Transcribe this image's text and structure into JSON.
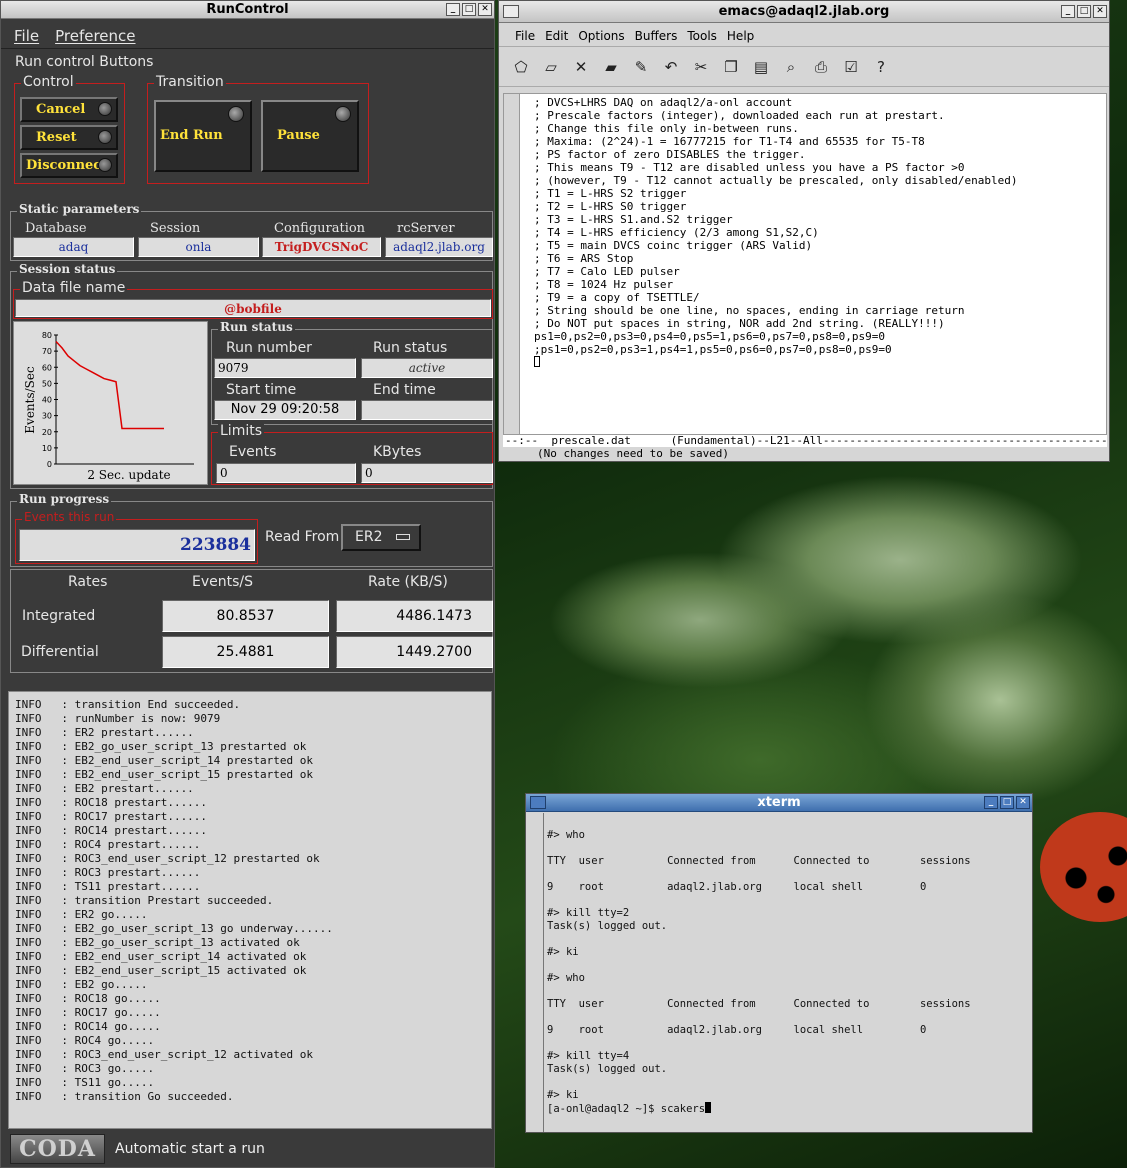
{
  "runcontrol": {
    "title": "RunControl",
    "menu": [
      "File",
      "Preference"
    ],
    "run_control_buttons_label": "Run control Buttons",
    "control_label": "Control",
    "transition_label": "Transition",
    "buttons": {
      "cancel": "Cancel",
      "reset": "Reset",
      "disconnect": "Disconnect",
      "end_run": "End Run",
      "pause": "Pause"
    },
    "static_params_label": "Static parameters",
    "static_params": {
      "database_label": "Database",
      "database": "adaq",
      "session_label": "Session",
      "session": "onla",
      "configuration_label": "Configuration",
      "configuration": "TrigDVCSNoC",
      "rcserver_label": "rcServer",
      "rcserver": "adaql2.jlab.org"
    },
    "session_status_label": "Session status",
    "data_file_label": "Data file name",
    "data_file": "@bobfile",
    "graph": {
      "ylabel": "Events/Sec",
      "xlabel": "2 Sec. update",
      "yticks": [
        "80",
        "70",
        "60",
        "50",
        "40",
        "30",
        "20",
        "10",
        "0"
      ]
    },
    "run_status_label": "Run status",
    "run_number_label": "Run number",
    "run_number": "9079",
    "run_state_label": "Run status",
    "run_state": "active",
    "start_time_label": "Start time",
    "start_time": "Nov 29 09:20:58",
    "end_time_label": "End time",
    "end_time": "",
    "limits_label": "Limits",
    "events_limit_label": "Events",
    "events_limit": "0",
    "kbytes_limit_label": "KBytes",
    "kbytes_limit": "0",
    "run_progress_label": "Run progress",
    "events_this_run_label": "Events this run",
    "events_this_run": "223884",
    "read_from_label": "Read From:",
    "read_from": "ER2",
    "rates": {
      "header": [
        "Rates",
        "Events/S",
        "Rate (KB/S)"
      ],
      "integrated_label": "Integrated",
      "integrated_events": "80.8537",
      "integrated_rate": "4486.1473",
      "differential_label": "Differential",
      "differential_events": "25.4881",
      "differential_rate": "1449.2700"
    },
    "log": "INFO   : transition End succeeded.\nINFO   : runNumber is now: 9079\nINFO   : ER2 prestart......\nINFO   : EB2_go_user_script_13 prestarted ok\nINFO   : EB2_end_user_script_14 prestarted ok\nINFO   : EB2_end_user_script_15 prestarted ok\nINFO   : EB2 prestart......\nINFO   : ROC18 prestart......\nINFO   : ROC17 prestart......\nINFO   : ROC14 prestart......\nINFO   : ROC4 prestart......\nINFO   : ROC3_end_user_script_12 prestarted ok\nINFO   : ROC3 prestart......\nINFO   : TS11 prestart......\nINFO   : transition Prestart succeeded.\nINFO   : ER2 go.....\nINFO   : EB2_go_user_script_13 go underway......\nINFO   : EB2_go_user_script_13 activated ok\nINFO   : EB2_end_user_script_14 activated ok\nINFO   : EB2_end_user_script_15 activated ok\nINFO   : EB2 go.....\nINFO   : ROC18 go.....\nINFO   : ROC17 go.....\nINFO   : ROC14 go.....\nINFO   : ROC4 go.....\nINFO   : ROC3_end_user_script_12 activated ok\nINFO   : ROC3 go.....\nINFO   : TS11 go.....\nINFO   : transition Go succeeded.",
    "logo": "CODA",
    "status": "Automatic start a run"
  },
  "emacs": {
    "title": "emacs@adaql2.jlab.org",
    "menu": [
      "File",
      "Edit",
      "Options",
      "Buffers",
      "Tools",
      "Help"
    ],
    "toolbar_icons": [
      "new-file-icon",
      "open-folder-icon",
      "close-icon",
      "save-icon",
      "save-as-icon",
      "undo-icon",
      "cut-icon",
      "copy-icon",
      "paste-icon",
      "search-icon",
      "print-icon",
      "customize-icon",
      "help-icon"
    ],
    "text": "; DVCS+LHRS DAQ on adaql2/a-onl account\n; Prescale factors (integer), downloaded each run at prestart.\n; Change this file only in-between runs.\n; Maxima: (2^24)-1 = 16777215 for T1-T4 and 65535 for T5-T8\n; PS factor of zero DISABLES the trigger.\n; This means T9 - T12 are disabled unless you have a PS factor >0\n; (however, T9 - T12 cannot actually be prescaled, only disabled/enabled)\n; T1 = L-HRS S2 trigger\n; T2 = L-HRS S0 trigger\n; T3 = L-HRS S1.and.S2 trigger\n; T4 = L-HRS efficiency (2/3 among S1,S2,C)\n; T5 = main DVCS coinc trigger (ARS Valid)\n; T6 = ARS Stop\n; T7 = Calo LED pulser\n; T8 = 1024 Hz pulser\n; T9 = a copy of TSETTLE/\n; String should be one line, no spaces, ending in carriage return\n; Do NOT put spaces in string, NOR add 2nd string. (REALLY!!!)\nps1=0,ps2=0,ps3=0,ps4=0,ps5=1,ps6=0,ps7=0,ps8=0,ps9=0\n;ps1=0,ps2=0,ps3=1,ps4=1,ps5=0,ps6=0,ps7=0,ps8=0,ps9=0",
    "modeline": "--:--  prescale.dat      (Fundamental)--L21--All---------------------------------------------",
    "echo": "(No changes need to be saved)"
  },
  "xterm": {
    "title": "xterm",
    "text": "\n#> who\n\nTTY  user          Connected from      Connected to        sessions\n\n9    root          adaql2.jlab.org     local shell         0\n\n#> kill tty=2\nTask(s) logged out.\n\n#> ki\n\n#> who\n\nTTY  user          Connected from      Connected to        sessions\n\n9    root          adaql2.jlab.org     local shell         0\n\n#> kill tty=4\nTask(s) logged out.\n\n#> ki\n[a-onl@adaql2 ~]$ scakers"
  },
  "graph_data": {
    "y_max": 80,
    "points": [
      [
        0,
        76
      ],
      [
        2,
        72
      ],
      [
        4,
        67
      ],
      [
        6,
        64
      ],
      [
        8,
        61
      ],
      [
        10,
        59
      ],
      [
        12,
        57
      ],
      [
        14,
        55
      ],
      [
        16,
        53
      ],
      [
        18,
        52
      ],
      [
        20,
        51
      ],
      [
        22,
        22
      ],
      [
        24,
        22
      ],
      [
        26,
        22
      ],
      [
        28,
        22
      ],
      [
        30,
        22
      ],
      [
        32,
        22
      ],
      [
        34,
        22
      ],
      [
        36,
        22
      ]
    ]
  }
}
